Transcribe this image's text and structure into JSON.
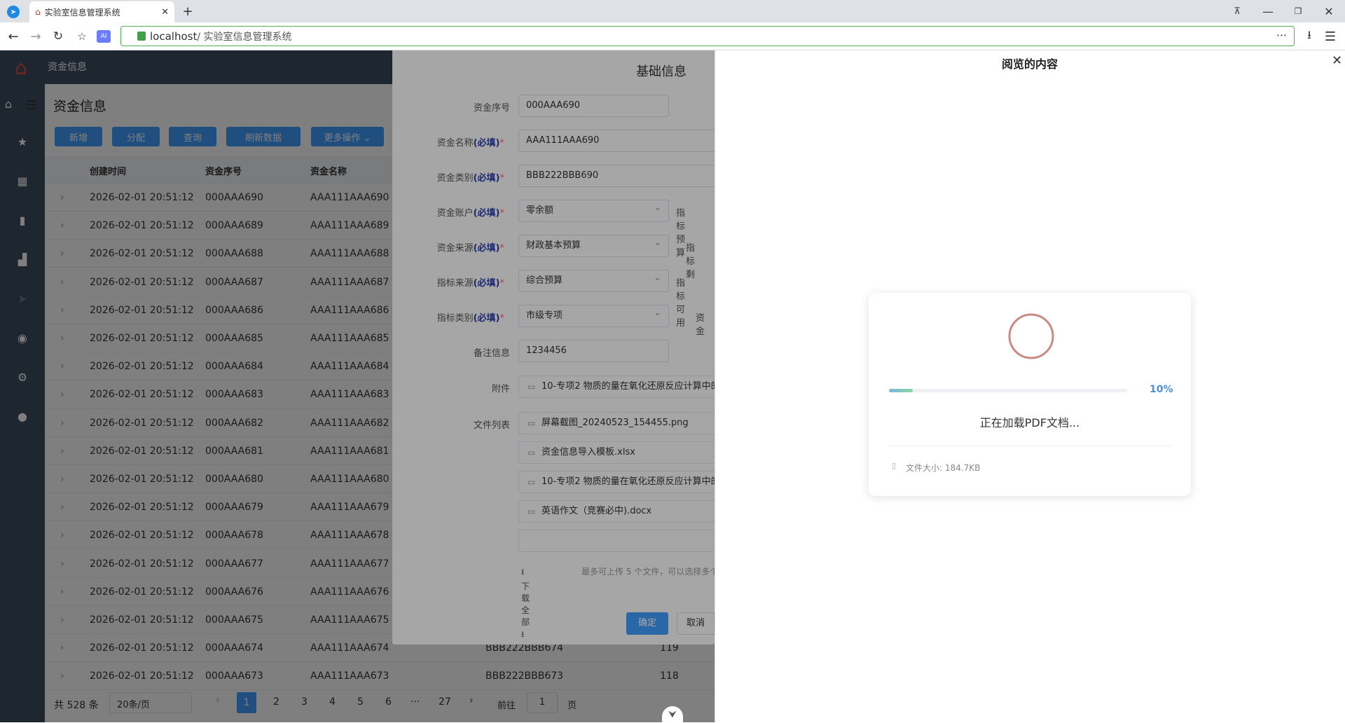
{
  "browser": {
    "tab_title": "实验室信息管理系统",
    "url_host": "localhost",
    "url_path": " / 实验室信息管理系统"
  },
  "app": {
    "header_title": "资金信息",
    "page_title": "资金信息",
    "toolbar": {
      "add": "新增",
      "assign": "分配",
      "query": "查询",
      "refresh": "刷新数据",
      "more": "更多操作 ⌄"
    },
    "table": {
      "columns": [
        "创建时间",
        "资金序号",
        "资金名称"
      ],
      "rows": [
        {
          "time": "2026-02-01 20:51:12",
          "serial": "000AAA690",
          "name": "AAA111AAA690"
        },
        {
          "time": "2026-02-01 20:51:12",
          "serial": "000AAA689",
          "name": "AAA111AAA689"
        },
        {
          "time": "2026-02-01 20:51:12",
          "serial": "000AAA688",
          "name": "AAA111AAA688"
        },
        {
          "time": "2026-02-01 20:51:12",
          "serial": "000AAA687",
          "name": "AAA111AAA687"
        },
        {
          "time": "2026-02-01 20:51:12",
          "serial": "000AAA686",
          "name": "AAA111AAA686"
        },
        {
          "time": "2026-02-01 20:51:12",
          "serial": "000AAA685",
          "name": "AAA111AAA685"
        },
        {
          "time": "2026-02-01 20:51:12",
          "serial": "000AAA684",
          "name": "AAA111AAA684"
        },
        {
          "time": "2026-02-01 20:51:12",
          "serial": "000AAA683",
          "name": "AAA111AAA683"
        },
        {
          "time": "2026-02-01 20:51:12",
          "serial": "000AAA682",
          "name": "AAA111AAA682"
        },
        {
          "time": "2026-02-01 20:51:12",
          "serial": "000AAA681",
          "name": "AAA111AAA681"
        },
        {
          "time": "2026-02-01 20:51:12",
          "serial": "000AAA680",
          "name": "AAA111AAA680"
        },
        {
          "time": "2026-02-01 20:51:12",
          "serial": "000AAA679",
          "name": "AAA111AAA679"
        },
        {
          "time": "2026-02-01 20:51:12",
          "serial": "000AAA678",
          "name": "AAA111AAA678"
        },
        {
          "time": "2026-02-01 20:51:12",
          "serial": "000AAA677",
          "name": "AAA111AAA677"
        },
        {
          "time": "2026-02-01 20:51:12",
          "serial": "000AAA676",
          "name": "AAA111AAA676"
        },
        {
          "time": "2026-02-01 20:51:12",
          "serial": "000AAA675",
          "name": "AAA111AAA675"
        },
        {
          "time": "2026-02-01 20:51:12",
          "serial": "000AAA674",
          "name": "AAA111AAA674",
          "category": "BBB222BBB674",
          "num": "119"
        },
        {
          "time": "2026-02-01 20:51:12",
          "serial": "000AAA673",
          "name": "AAA111AAA673",
          "category": "BBB222BBB673",
          "num": "118"
        }
      ]
    },
    "pagination": {
      "total": "共 528 条",
      "page_size": "20条/页",
      "prev": "‹",
      "pages": [
        "1",
        "2",
        "3",
        "4",
        "5",
        "6"
      ],
      "ellipsis": "···",
      "last": "27",
      "next": "›",
      "goto_label": "前往",
      "goto_value": "1",
      "page_suffix": "页"
    }
  },
  "dialog": {
    "title": "基础信息",
    "required_tag": "(必填)",
    "fields": {
      "serial": {
        "label": "资金序号",
        "value": "000AAA690"
      },
      "name": {
        "label": "资金名称",
        "value": "AAA111AAA690"
      },
      "category": {
        "label": "资金类别",
        "value": "BBB222BBB690"
      },
      "account": {
        "label": "资金账户",
        "value": "零余额",
        "side": "指标预算"
      },
      "source": {
        "label": "资金来源",
        "value": "财政基本预算",
        "side": "指标剩"
      },
      "index_source": {
        "label": "指标来源",
        "value": "综合预算",
        "side": "指标可用"
      },
      "index_category": {
        "label": "指标类别",
        "value": "市级专项",
        "side": "资金"
      },
      "remark": {
        "label": "备注信息",
        "value": "1234456"
      },
      "attachment": {
        "label": "附件",
        "value": "10-专项2 物质的量在氧化还原反应计算中的"
      },
      "file_list_label": "文件列表"
    },
    "files": [
      "屏幕截图_20240523_154455.png",
      "资金信息导入模板.xlsx",
      "10-专项2 物质的量在氧化还原反应计算中的",
      "英语作文（竞赛必中).docx"
    ],
    "download_all": "⭳下载全部⭳",
    "upload_hint": "最多可上传 5 个文件，可以选择多个",
    "confirm": "确定",
    "cancel": "取消"
  },
  "viewer": {
    "title": "阅览的内容",
    "progress_percent": 10,
    "progress_label": "10%",
    "loading_text": "正在加载PDF文档...",
    "file_size": "文件大小: 184.7KB"
  },
  "colors": {
    "sidebar": "#3c4d61",
    "primary": "#409eff",
    "progress_blue": "#4a90e2"
  }
}
